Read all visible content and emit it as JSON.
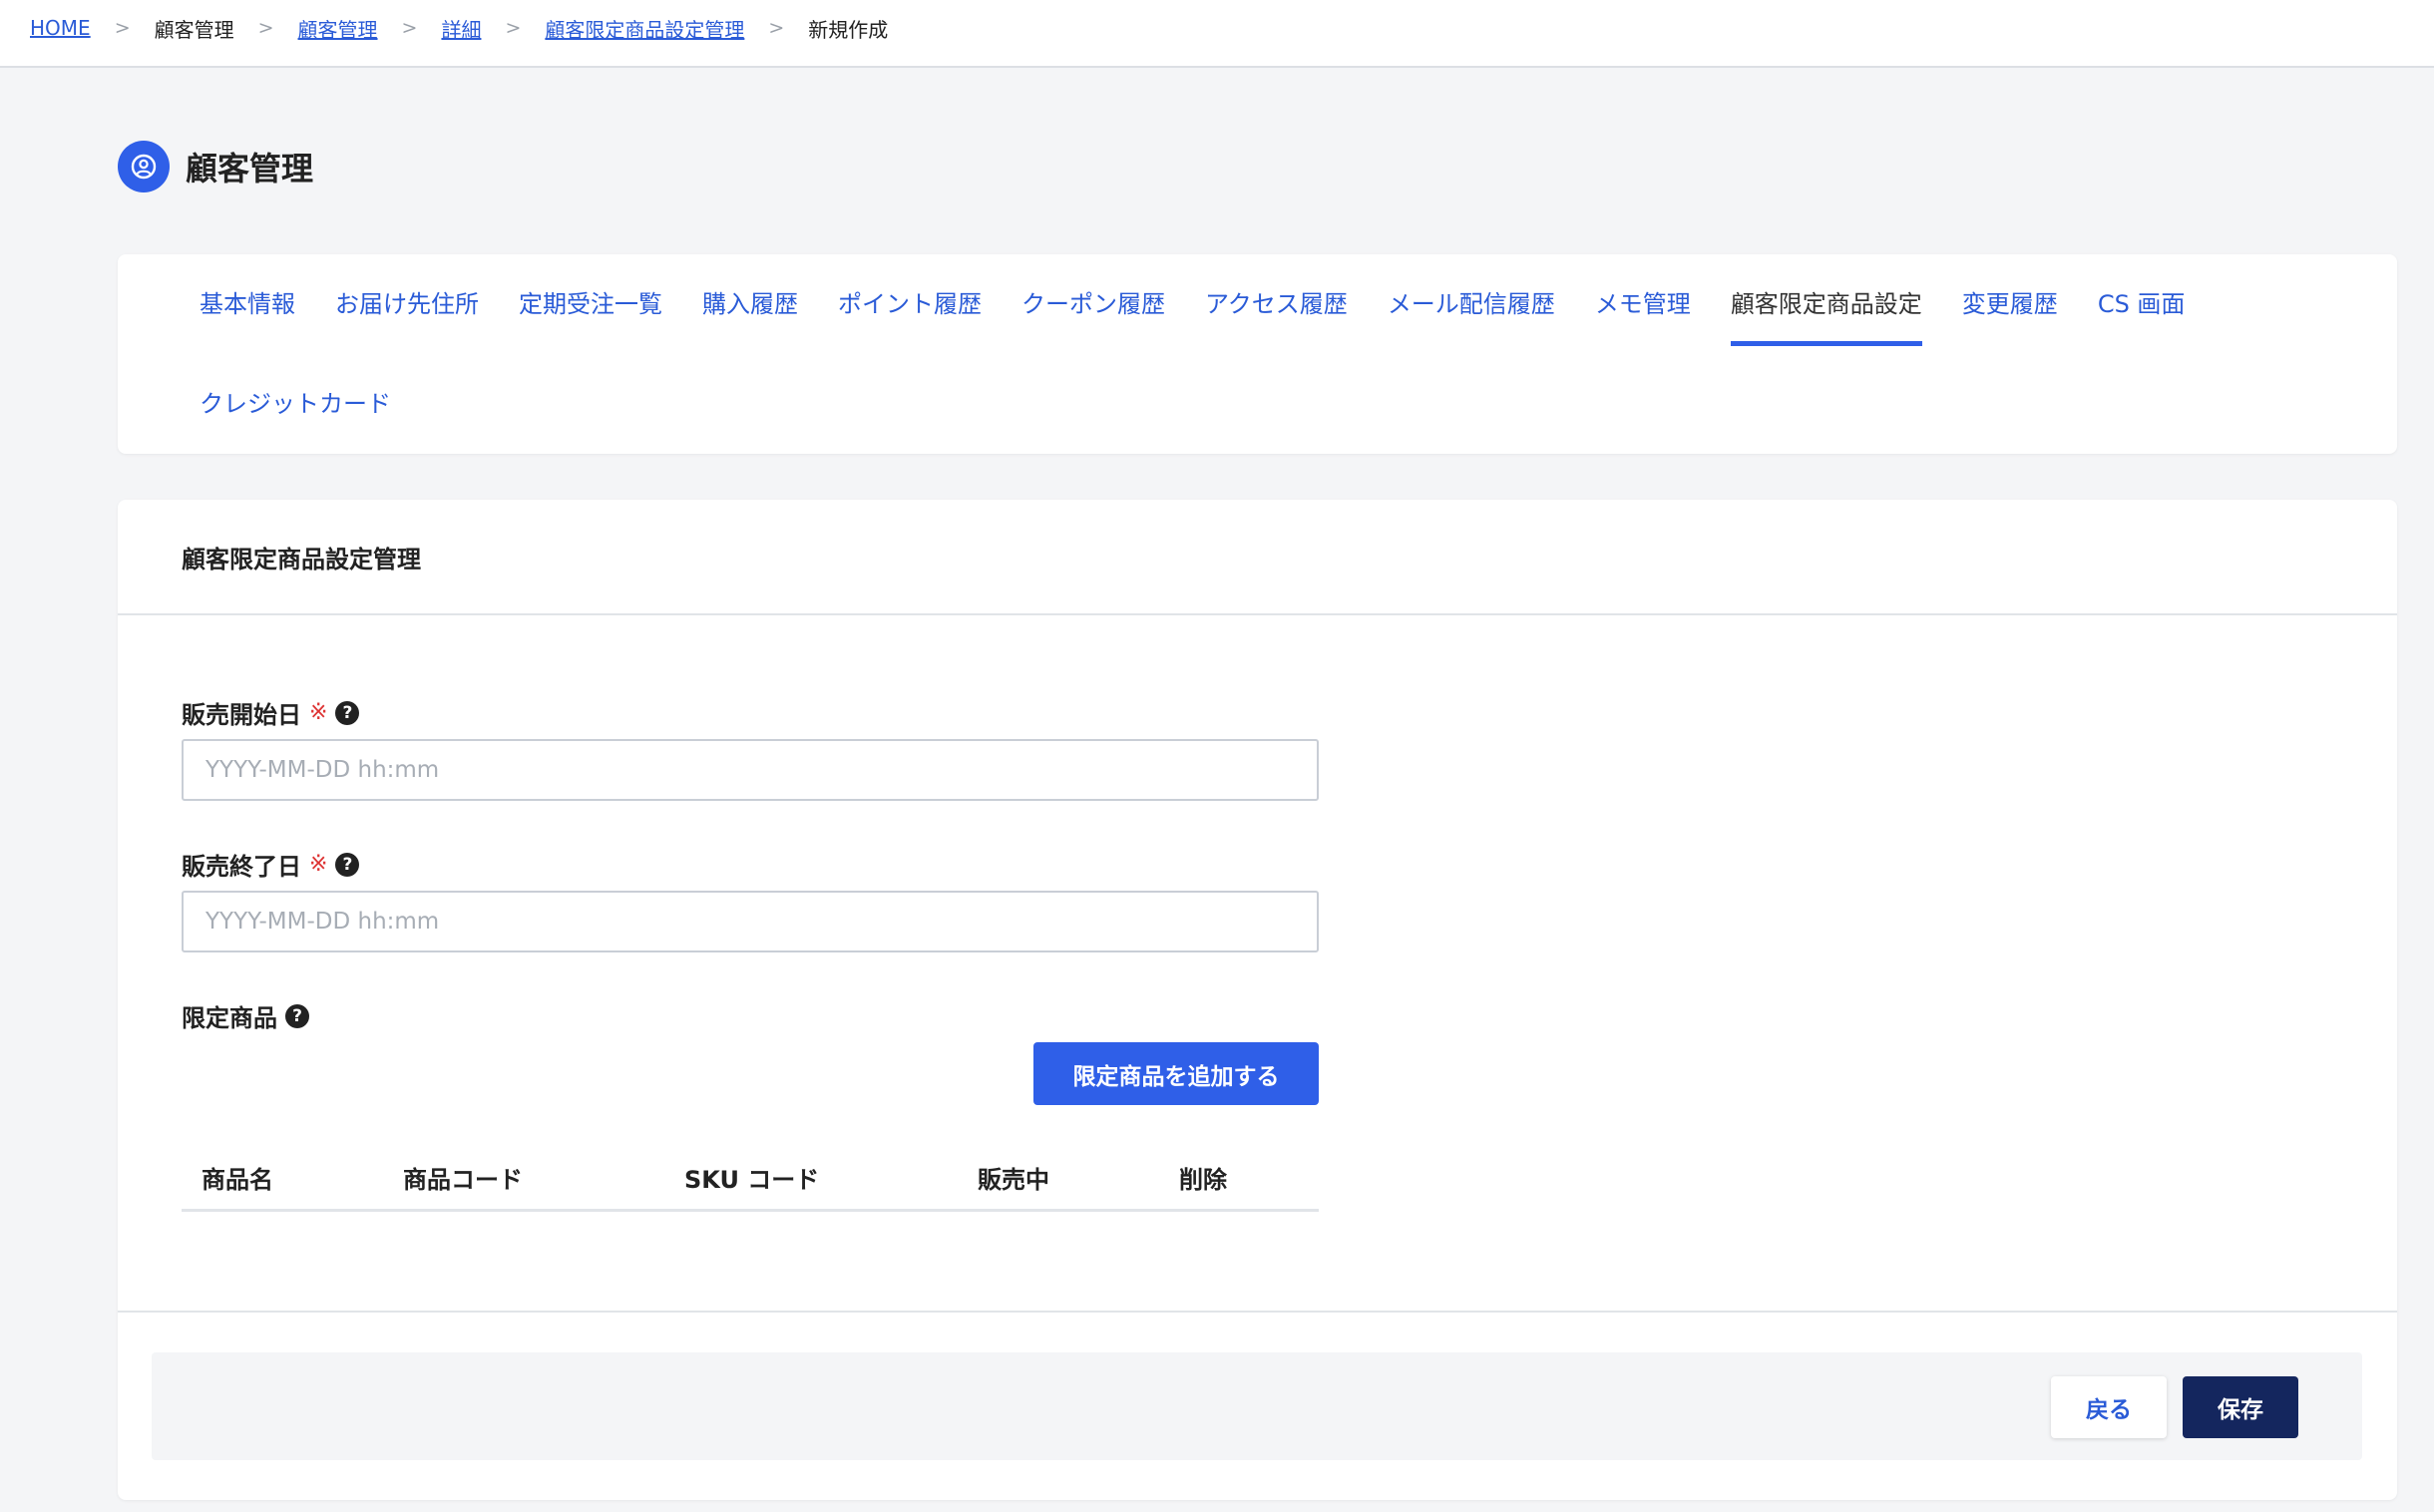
{
  "breadcrumb": [
    {
      "label": "HOME",
      "link": true
    },
    {
      "label": "顧客管理",
      "link": false
    },
    {
      "label": "顧客管理",
      "link": true
    },
    {
      "label": "詳細",
      "link": true
    },
    {
      "label": "顧客限定商品設定管理",
      "link": true
    },
    {
      "label": "新規作成",
      "link": false
    }
  ],
  "breadcrumb_separator": ">",
  "page": {
    "title": "顧客管理",
    "icon": "user-circle-icon"
  },
  "tabs": [
    {
      "label": "基本情報"
    },
    {
      "label": "お届け先住所"
    },
    {
      "label": "定期受注一覧"
    },
    {
      "label": "購入履歴"
    },
    {
      "label": "ポイント履歴"
    },
    {
      "label": "クーポン履歴"
    },
    {
      "label": "アクセス履歴"
    },
    {
      "label": "メール配信履歴"
    },
    {
      "label": "メモ管理"
    },
    {
      "label": "顧客限定商品設定",
      "active": true
    },
    {
      "label": "変更履歴"
    },
    {
      "label": "CS 画面"
    },
    {
      "label": "クレジットカード"
    }
  ],
  "form": {
    "section_title": "顧客限定商品設定管理",
    "start_date": {
      "label": "販売開始日",
      "required_mark": "※",
      "placeholder": "YYYY-MM-DD hh:mm",
      "value": ""
    },
    "end_date": {
      "label": "販売終了日",
      "required_mark": "※",
      "placeholder": "YYYY-MM-DD hh:mm",
      "value": ""
    },
    "limited_products": {
      "label": "限定商品",
      "add_button": "限定商品を追加する"
    },
    "help_icon": "?"
  },
  "table": {
    "columns": [
      "商品名",
      "商品コード",
      "SKU コード",
      "販売中",
      "削除"
    ],
    "rows": []
  },
  "footer": {
    "back_label": "戻る",
    "save_label": "保存"
  },
  "colors": {
    "accent": "#2f5fe8",
    "link": "#2a5bd7",
    "primary_dark": "#14265e",
    "required": "#dd3333"
  }
}
